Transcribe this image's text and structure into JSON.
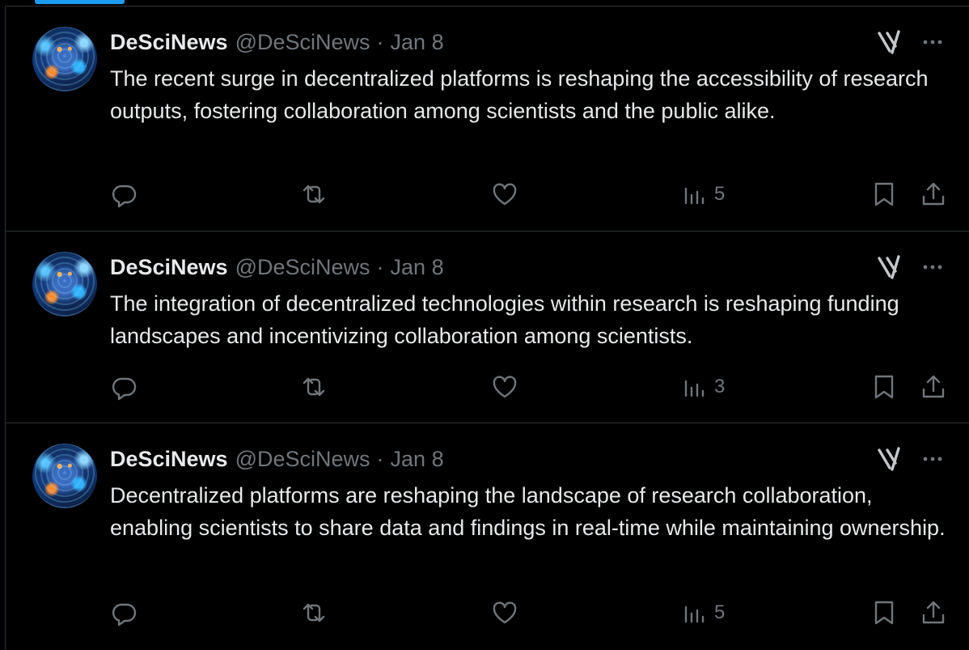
{
  "tweets": [
    {
      "author": "DeSciNews",
      "handle": "@DeSciNews",
      "separator": "·",
      "date": "Jan 8",
      "text": "The recent surge in decentralized platforms is reshaping the accessibility of research outputs, fostering collaboration among scientists and the public alike.",
      "views": "5"
    },
    {
      "author": "DeSciNews",
      "handle": "@DeSciNews",
      "separator": "·",
      "date": "Jan 8",
      "text": "The integration of decentralized technologies within research is reshaping funding landscapes and incentivizing collaboration among scientists.",
      "views": "3"
    },
    {
      "author": "DeSciNews",
      "handle": "@DeSciNews",
      "separator": "·",
      "date": "Jan 8",
      "text": "Decentralized platforms are reshaping the landscape of research collaboration, enabling scientists to share data and findings in real-time while maintaining ownership.",
      "views": "5"
    }
  ],
  "icons": {
    "reply": "reply-icon",
    "repost": "repost-icon",
    "like": "like-icon",
    "views": "views-icon",
    "bookmark": "bookmark-icon",
    "share": "share-icon",
    "grok": "grok-icon",
    "more": "more-icon"
  },
  "colors": {
    "background": "#000000",
    "text": "#e7e9ea",
    "secondary": "#71767b",
    "border": "#2f3336",
    "accent": "#1d9bf0"
  }
}
